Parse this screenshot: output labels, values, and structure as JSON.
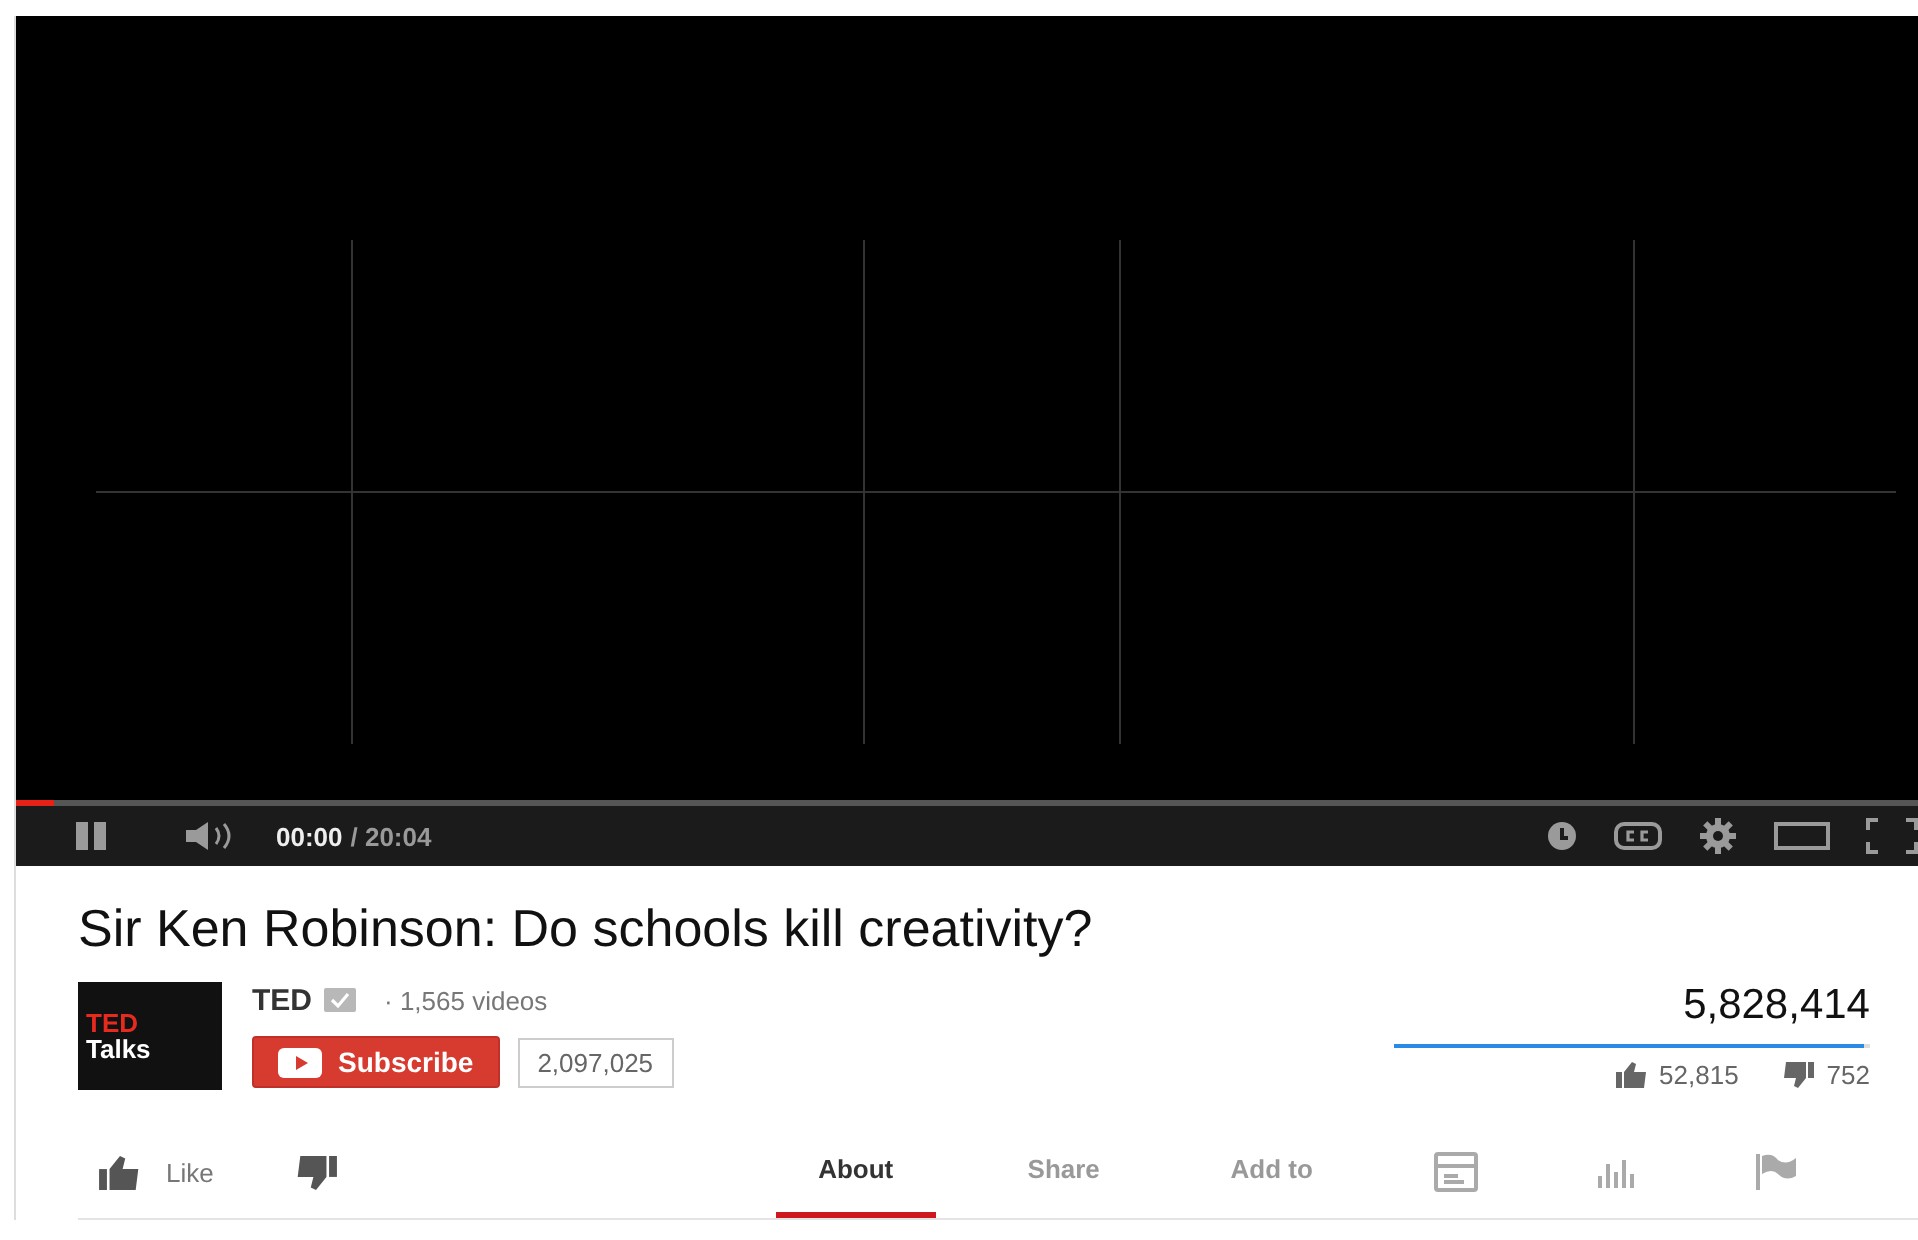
{
  "player": {
    "progress": {
      "level": 0.02
    },
    "playing": true,
    "current_time": "00:00",
    "duration": "/ 20:04"
  },
  "video_title": "Sir Ken Robinson: Do schools kill creativity?",
  "channel": {
    "logo_lines": [
      "TED",
      "Talks"
    ],
    "name": "TED",
    "verified": true,
    "video_count": "· 1,565 videos",
    "subscribe_label": "Subscribe",
    "subscriber_count": "2,097,025"
  },
  "stats": {
    "views": "5,828,414",
    "rating": {
      "level": 0.986
    },
    "likes": "52,815",
    "dislikes": "752"
  },
  "actions": {
    "like_label": "Like"
  },
  "tabs": [
    {
      "label": "About",
      "selected": true
    },
    {
      "label": "Share",
      "selected": false
    },
    {
      "label": "Add to",
      "selected": false
    }
  ]
}
